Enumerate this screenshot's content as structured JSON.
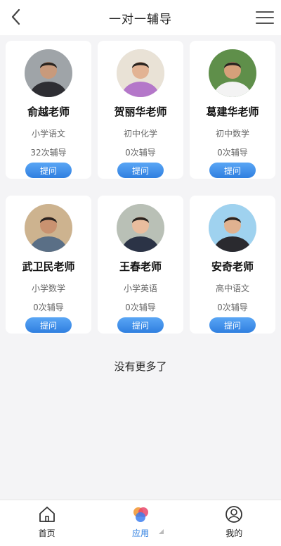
{
  "header": {
    "title": "一对一辅导"
  },
  "teachers": [
    {
      "name": "俞越老师",
      "subject": "小学语文",
      "count": "32次辅导",
      "ask": "提问",
      "palette": {
        "bg": "#9fa4a8",
        "skin": "#c89a7c",
        "shirt": "#2e2e33"
      }
    },
    {
      "name": "贺丽华老师",
      "subject": "初中化学",
      "count": "0次辅导",
      "ask": "提问",
      "palette": {
        "bg": "#e9e2d6",
        "skin": "#e2b394",
        "shirt": "#b477c9"
      }
    },
    {
      "name": "葛建华老师",
      "subject": "初中数学",
      "count": "0次辅导",
      "ask": "提问",
      "palette": {
        "bg": "#5f8f4a",
        "skin": "#d6a07a",
        "shirt": "#f3f3f3"
      }
    },
    {
      "name": "武卫民老师",
      "subject": "小学数学",
      "count": "0次辅导",
      "ask": "提问",
      "palette": {
        "bg": "#cdb38f",
        "skin": "#c99270",
        "shirt": "#5a6f86"
      }
    },
    {
      "name": "王春老师",
      "subject": "小学英语",
      "count": "0次辅导",
      "ask": "提问",
      "palette": {
        "bg": "#b9c0b6",
        "skin": "#e9bd9e",
        "shirt": "#2b3346"
      }
    },
    {
      "name": "安奇老师",
      "subject": "高中语文",
      "count": "0次辅导",
      "ask": "提问",
      "palette": {
        "bg": "#9fd2ef",
        "skin": "#e0b290",
        "shirt": "#2a2a2f"
      }
    }
  ],
  "footer_text": "没有更多了",
  "tabbar": {
    "home": {
      "label": "首页",
      "icon": "home-icon"
    },
    "apps": {
      "label": "应用",
      "icon": "apps-icon"
    },
    "mine": {
      "label": "我的",
      "icon": "user-icon"
    }
  },
  "colors": {
    "accent": "#2f7fe0",
    "button_gradient_top": "#5aa6f5"
  }
}
